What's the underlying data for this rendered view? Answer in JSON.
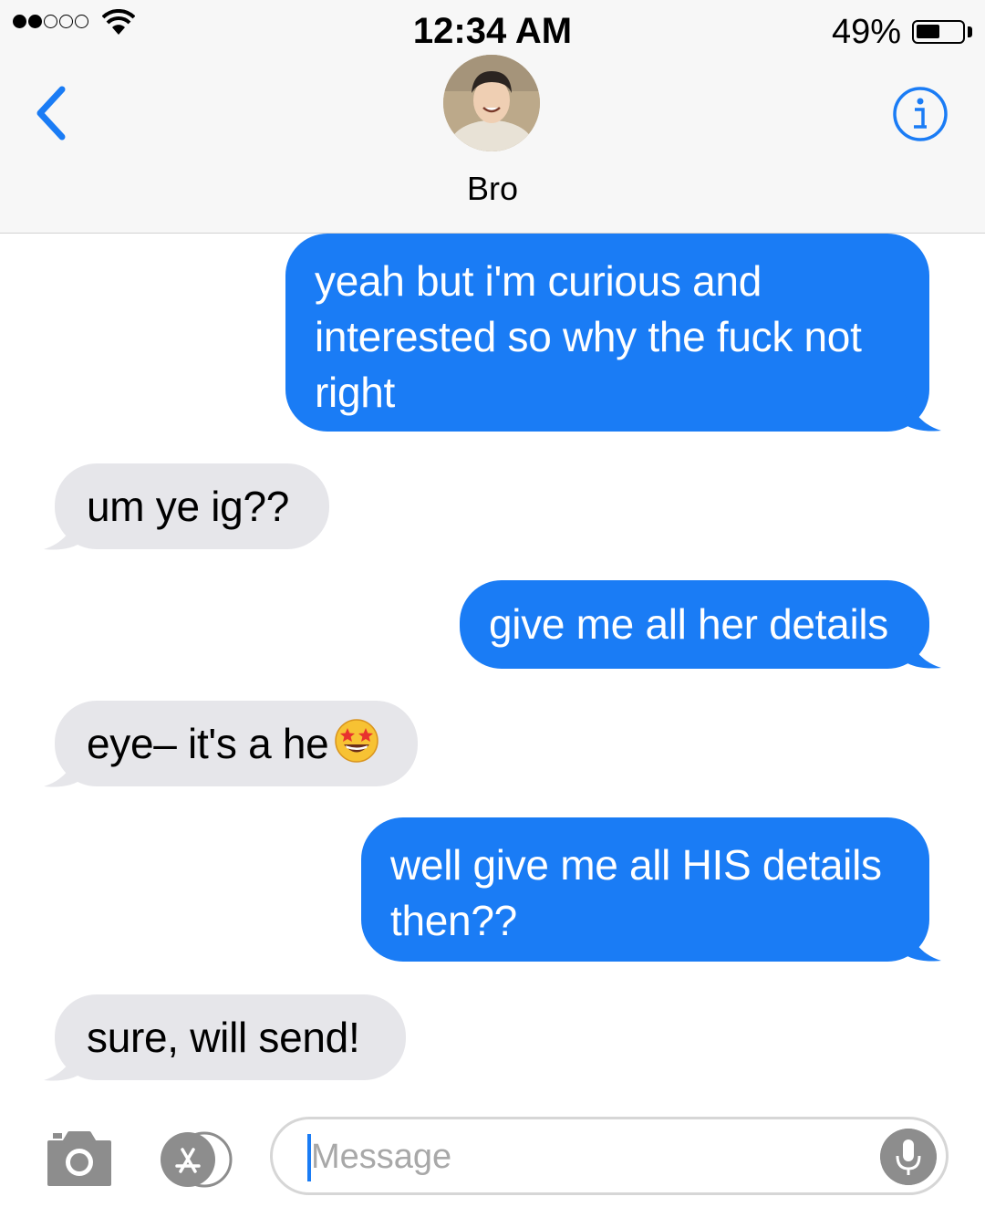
{
  "status_bar": {
    "signal_dots_filled": 2,
    "signal_dots_total": 5,
    "time": "12:34 AM",
    "battery_percent_label": "49%",
    "battery_level": 0.49
  },
  "header": {
    "back_icon": "chevron-left-icon",
    "contact_name": "Bro",
    "info_icon": "info-icon"
  },
  "messages": [
    {
      "direction": "sent",
      "lines": [
        "yeah but i'm curious and",
        "interested so why the fuck not",
        "right"
      ]
    },
    {
      "direction": "received",
      "lines": [
        "um ye ig??"
      ]
    },
    {
      "direction": "sent",
      "lines": [
        "give me all her details"
      ]
    },
    {
      "direction": "received",
      "lines": [
        "eye– it's a he"
      ],
      "emoji": "star-struck-emoji"
    },
    {
      "direction": "sent",
      "lines": [
        "well give me all HIS details",
        "then??"
      ]
    },
    {
      "direction": "received",
      "lines": [
        "sure, will send!"
      ]
    }
  ],
  "input_bar": {
    "camera_icon": "camera-icon",
    "apps_icon": "app-store-icon",
    "placeholder": "Message",
    "mic_icon": "microphone-icon"
  },
  "colors": {
    "sent_bubble": "#1a7cf5",
    "received_bubble": "#e6e6ea",
    "accent": "#1a7cf5"
  }
}
